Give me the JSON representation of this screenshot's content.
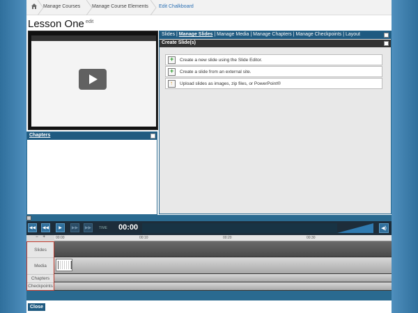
{
  "breadcrumb": {
    "items": [
      "Manage Courses",
      "Manage Course Elements",
      "Edit Chalkboard"
    ]
  },
  "page": {
    "title": "Lesson One",
    "edit_label": "edit"
  },
  "chapters": {
    "header": "Chapters"
  },
  "slides": {
    "nav_prefix": "Slides | ",
    "nav_active": "Manage Slides",
    "nav_rest": " | Manage Media | Manage Chapters | Manage Checkpoints | Layout",
    "subheader": "Create Slide(s)",
    "options": [
      "Create a new slide using the Slide Editor.",
      "Create a slide from an external site.",
      "Upload slides as images, zip files, or PowerPoint®"
    ]
  },
  "player": {
    "time_label": "TIME",
    "time": "00:00"
  },
  "timeline": {
    "zoom_minus": "−",
    "zoom_plus": "+",
    "ticks": [
      "00:00",
      "00:10",
      "00:20",
      "00:30"
    ],
    "tracks": [
      "Slides",
      "Media",
      "Chapters",
      "Checkpoints"
    ]
  },
  "footer": {
    "close_label": "Close"
  },
  "colors": {
    "accent": "#1f5a80",
    "link": "#2a6fb3",
    "dark_bar": "#1d2d3a"
  }
}
